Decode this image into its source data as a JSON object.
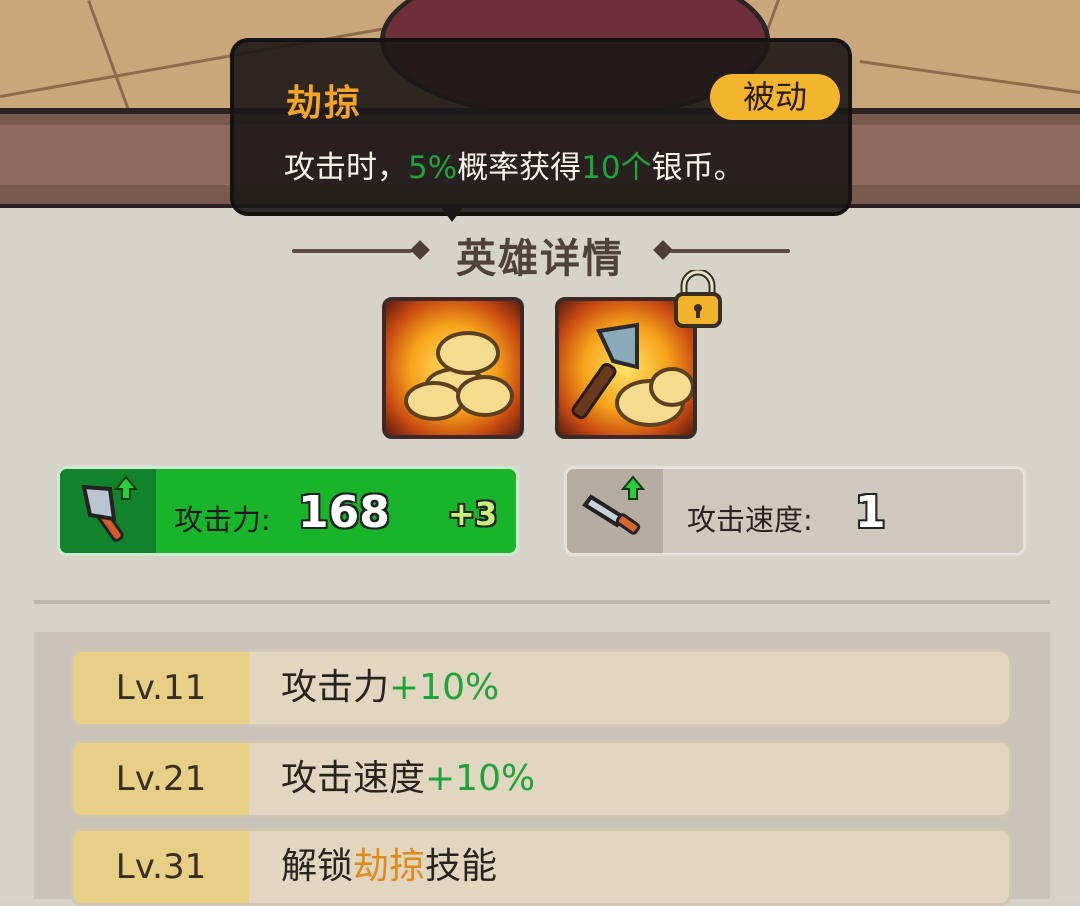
{
  "tooltip": {
    "title": "劫掠",
    "badge": "被动",
    "desc_prefix": "攻击时，",
    "desc_chance": "5%",
    "desc_mid": "概率获得",
    "desc_amount": "10个",
    "desc_suffix": "银币。"
  },
  "section_title": "英雄详情",
  "skills": [
    {
      "icon": "coins-skill-icon",
      "locked": false
    },
    {
      "icon": "axe-coins-skill-icon",
      "locked": true
    }
  ],
  "stats": {
    "attack": {
      "label": "攻击力:",
      "value": "168",
      "bonus": "+3",
      "icon": "axe-upgrade-icon",
      "color": "#18b52a"
    },
    "speed": {
      "label": "攻击速度:",
      "value": "1",
      "icon": "sword-upgrade-icon"
    }
  },
  "levels": [
    {
      "level": "Lv.11",
      "text": "攻击力",
      "highlight": "+10%",
      "suffix": ""
    },
    {
      "level": "Lv.21",
      "text": "攻击速度",
      "highlight": "+10%",
      "suffix": ""
    },
    {
      "level": "Lv.31",
      "text": "解锁",
      "highlight": "劫掠",
      "suffix": "技能"
    }
  ],
  "colors": {
    "accent_orange": "#f3a52a",
    "bonus_green": "#1fa43a",
    "badge": "#f4b52e"
  }
}
